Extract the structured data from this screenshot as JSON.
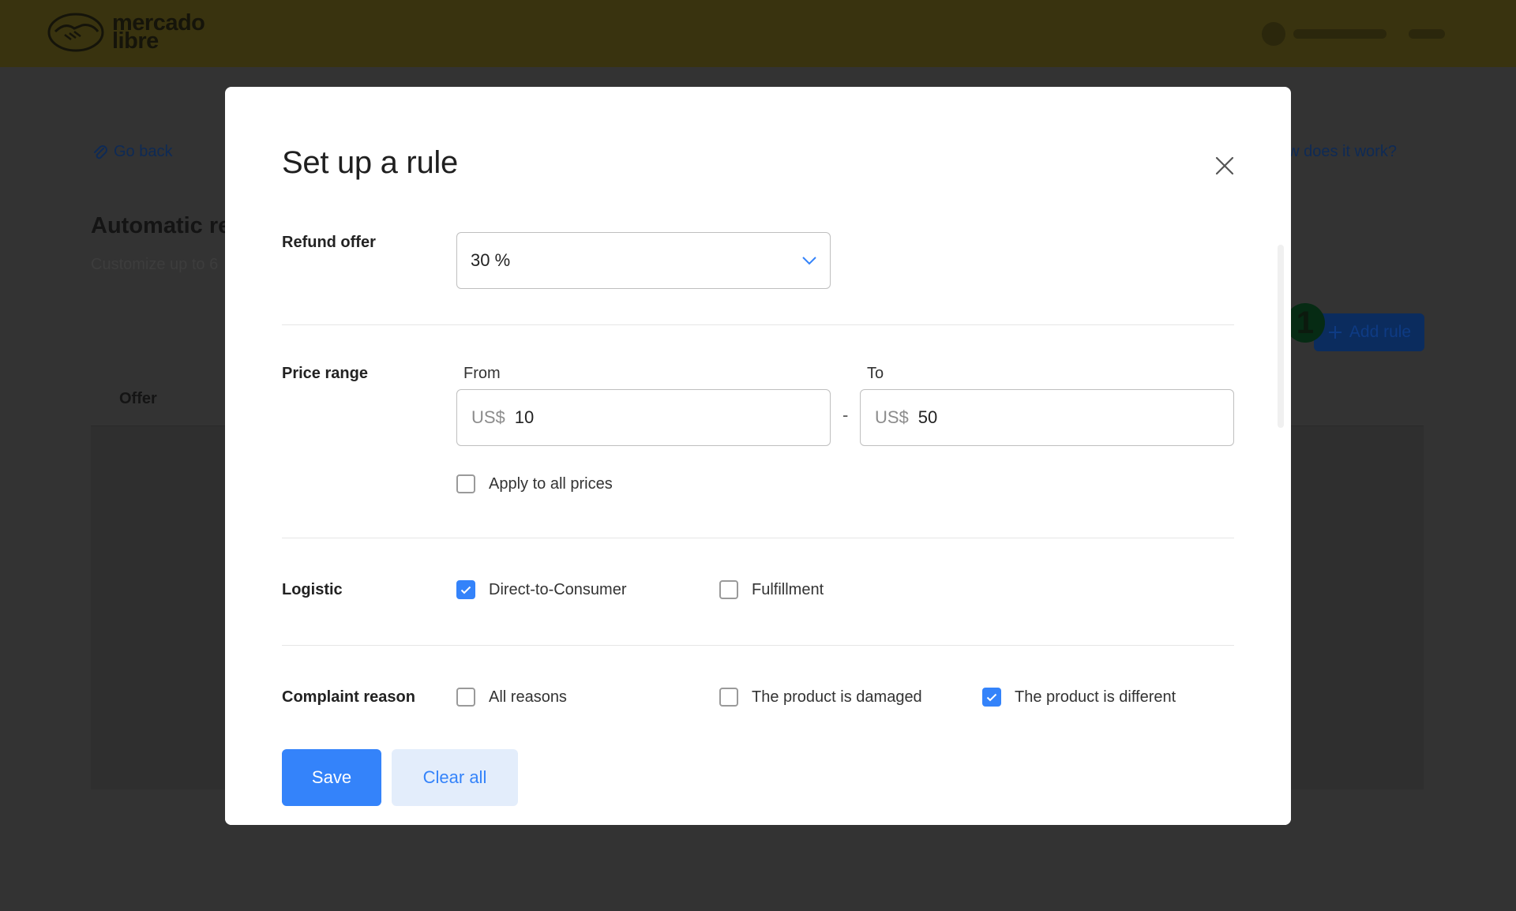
{
  "header": {
    "logo": {
      "line1": "mercado",
      "line2": "libre",
      "icon": "handshake-logo-icon"
    }
  },
  "background": {
    "go_back": "Go back",
    "how_it_works": "ow does it work?",
    "title": "Automatic re",
    "subtitle": "Customize up to 6",
    "table_header_offer": "Offer",
    "add_rule": "Add rule",
    "badge_count": "1"
  },
  "modal": {
    "title": "Set up a rule",
    "refund_offer": {
      "label": "Refund offer",
      "selected": "30 %"
    },
    "price_range": {
      "label": "Price range",
      "from_label": "From",
      "to_label": "To",
      "currency": "US$",
      "from_value": "10",
      "to_value": "50",
      "separator": "-",
      "apply_all": {
        "label": "Apply to all prices",
        "checked": false
      }
    },
    "logistic": {
      "label": "Logistic",
      "options": [
        {
          "label": "Direct-to-Consumer",
          "checked": true
        },
        {
          "label": "Fulfillment",
          "checked": false
        }
      ]
    },
    "complaint_reason": {
      "label": "Complaint reason",
      "options": [
        {
          "label": "All reasons",
          "checked": false
        },
        {
          "label": "The product is damaged",
          "checked": false
        },
        {
          "label": "The product is different",
          "checked": true
        }
      ]
    },
    "actions": {
      "save": "Save",
      "clear_all": "Clear all"
    }
  },
  "colors": {
    "accent": "#3483fa",
    "accent_light": "#e3edfb",
    "overlay_header": "#39330f",
    "overlay_bg": "#333333"
  }
}
